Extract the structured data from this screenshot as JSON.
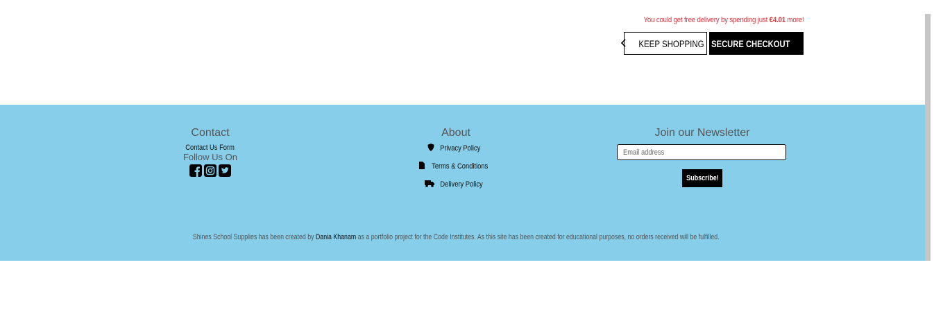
{
  "bag": {
    "delivery_prefix": "You could get free delivery by spending just",
    "delivery_amount": "€4.01",
    "delivery_suffix": "more!",
    "keep_shopping_label": "KEEP SHOPPING",
    "secure_checkout_label": "SECURE CHECKOUT"
  },
  "footer": {
    "contact": {
      "heading": "Contact",
      "form_link": "Contact Us Form",
      "follow_label": "Follow Us On",
      "social_icons": [
        "facebook-icon",
        "instagram-icon",
        "twitter-icon"
      ]
    },
    "about": {
      "heading": "About",
      "links": [
        {
          "icon": "shield-icon",
          "label": "Privacy Policy"
        },
        {
          "icon": "file-icon",
          "label": "Terms & Conditions"
        },
        {
          "icon": "truck-icon",
          "label": "Delivery Policy"
        }
      ]
    },
    "newsletter": {
      "heading": "Join our Newsletter",
      "email_placeholder": "Email address",
      "subscribe_label": "Subscribe!"
    },
    "credits": {
      "prefix": "Shines School Supplies has been created by",
      "author": "Dania Khanam",
      "suffix": "as a portfolio project for the Code Institutes. As this site has been created for educational purposes, no orders received will be fulfilled."
    }
  },
  "colors": {
    "footer_bg": "#87ceea",
    "delivery_note": "#e0343c",
    "button_dark": "#000000"
  }
}
